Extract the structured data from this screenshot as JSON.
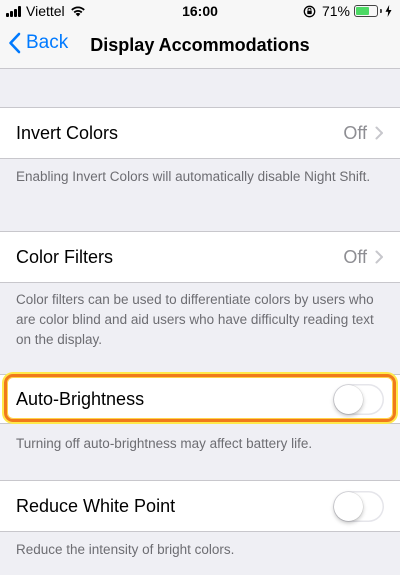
{
  "status_bar": {
    "carrier": "Viettel",
    "time": "16:00",
    "battery_percent": "71%",
    "battery_level": 0.71
  },
  "nav": {
    "back_label": "Back",
    "title": "Display Accommodations"
  },
  "sections": {
    "invert_colors": {
      "label": "Invert Colors",
      "value": "Off",
      "footer": "Enabling Invert Colors will automatically disable Night Shift."
    },
    "color_filters": {
      "label": "Color Filters",
      "value": "Off",
      "footer": "Color filters can be used to differentiate colors by users who are color blind and aid users who have difficulty reading text on the display."
    },
    "auto_brightness": {
      "label": "Auto-Brightness",
      "enabled": false,
      "footer": "Turning off auto-brightness may affect battery life."
    },
    "reduce_white_point": {
      "label": "Reduce White Point",
      "enabled": false,
      "footer": "Reduce the intensity of bright colors."
    }
  },
  "colors": {
    "accent": "#007aff",
    "background": "#efeff4",
    "highlight_outer": "#ffe94a",
    "highlight_inner": "#f07a1a"
  }
}
